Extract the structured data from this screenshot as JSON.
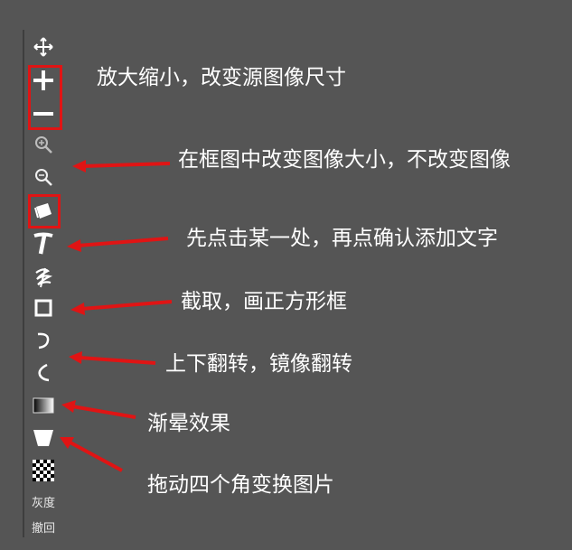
{
  "toolbar": {
    "tools": [
      {
        "icon": "move-icon"
      },
      {
        "icon": "zoom-in-plus-icon"
      },
      {
        "icon": "zoom-out-minus-icon"
      },
      {
        "icon": "magnify-plus-icon"
      },
      {
        "icon": "magnify-minus-icon"
      },
      {
        "icon": "eraser-icon"
      },
      {
        "icon": "text-tool-icon"
      },
      {
        "icon": "brush-scribble-icon"
      },
      {
        "icon": "crop-rectangle-icon"
      },
      {
        "icon": "flip-vertical-icon"
      },
      {
        "icon": "flip-horizontal-icon"
      },
      {
        "icon": "gradient-icon"
      },
      {
        "icon": "perspective-transform-icon"
      },
      {
        "icon": "checkerboard-icon"
      }
    ],
    "grayscale_label": "灰度",
    "undo_label": "撤回"
  },
  "annotations": {
    "zoom_note": "放大缩小，改变源图像尺寸",
    "frame_zoom_note": "在框图中改变图像大小，不改变图像",
    "text_note": "先点击某一处，再点确认添加文字",
    "crop_note": "截取，画正方形框",
    "flip_note": "上下翻转，镜像翻转",
    "gradient_note": "渐晕效果",
    "transform_note": "拖动四个角变换图片"
  },
  "colors": {
    "background": "#555555",
    "annotation_red": "#e01414",
    "icon_white": "#ffffff"
  }
}
